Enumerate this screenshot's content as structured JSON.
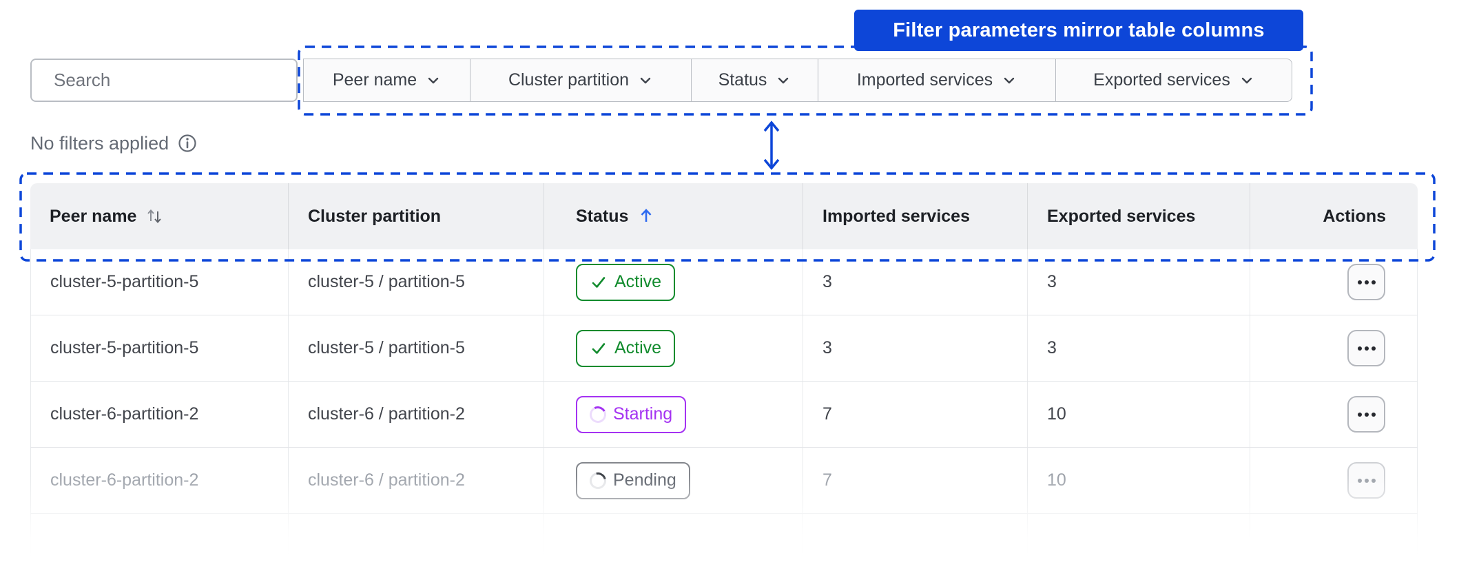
{
  "colors": {
    "annotation_blue": "#0d46d8",
    "sort_arrow_blue": "#2e6bf0",
    "active_green": "#118b2d",
    "starting_purple": "#a432f2",
    "pending_gray": "#84878d"
  },
  "annotation": {
    "banner_label": "Filter parameters mirror table columns"
  },
  "toolbar": {
    "search_placeholder": "Search",
    "filters": [
      {
        "label": "Peer name"
      },
      {
        "label": "Cluster partition"
      },
      {
        "label": "Status"
      },
      {
        "label": "Imported services"
      },
      {
        "label": "Exported services"
      }
    ],
    "status_text": "No filters applied"
  },
  "table": {
    "columns": [
      {
        "label": "Peer name",
        "sort": "sortable"
      },
      {
        "label": "Cluster partition"
      },
      {
        "label": "Status",
        "sort": "ascending"
      },
      {
        "label": "Imported services"
      },
      {
        "label": "Exported services"
      },
      {
        "label": "Actions"
      }
    ],
    "rows": [
      {
        "peer_name": "cluster-5-partition-5",
        "cluster_partition": "cluster-5 / partition-5",
        "status": "Active",
        "imported": "3",
        "exported": "3"
      },
      {
        "peer_name": "cluster-5-partition-5",
        "cluster_partition": "cluster-5 / partition-5",
        "status": "Active",
        "imported": "3",
        "exported": "3"
      },
      {
        "peer_name": "cluster-6-partition-2",
        "cluster_partition": "cluster-6 / partition-2",
        "status": "Starting",
        "imported": "7",
        "exported": "10"
      },
      {
        "peer_name": "cluster-6-partition-2",
        "cluster_partition": "cluster-6 / partition-2",
        "status": "Pending",
        "imported": "7",
        "exported": "10"
      }
    ]
  },
  "icons": {
    "search": "magnifier",
    "filter_chevron": "chevron-down",
    "peer_name_sort": "sort-up-down-arrows",
    "status_sort": "arrow-up",
    "info": "info-circle",
    "active_status": "check",
    "starting_status": "spinner",
    "pending_status": "spinner",
    "row_actions": "ellipsis-dots",
    "annotation_arrow": "double-headed-vertical-arrow"
  }
}
